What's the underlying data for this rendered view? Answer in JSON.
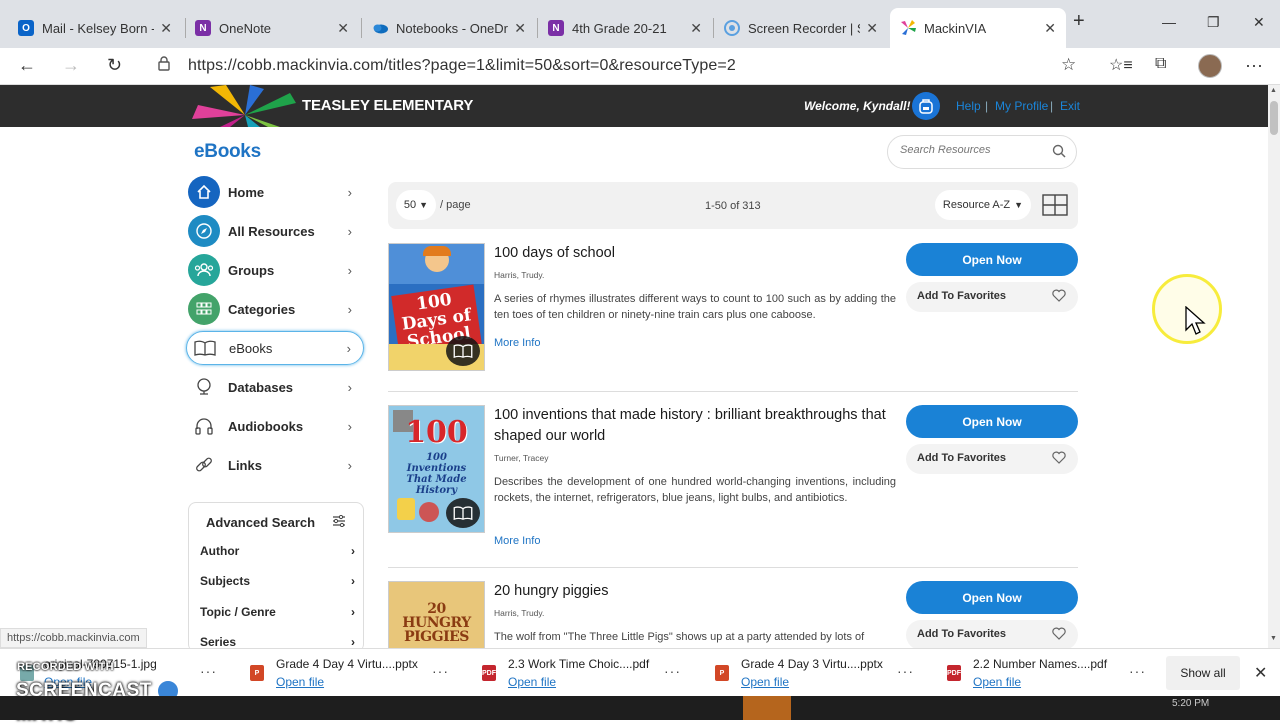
{
  "browser": {
    "tabs": [
      {
        "title": "Mail - Kelsey Born - O",
        "icon": "outlook-icon",
        "color": "#0a64c8",
        "letter": "O"
      },
      {
        "title": "OneNote",
        "icon": "onenote-icon",
        "color": "#7b2fa6",
        "letter": "N"
      },
      {
        "title": "Notebooks - OneDri",
        "icon": "onedrive-icon",
        "color": "#0f6cbd",
        "letter": ""
      },
      {
        "title": "4th Grade 20-21",
        "icon": "onenote-icon",
        "color": "#7b2fa6",
        "letter": "N"
      },
      {
        "title": "Screen Recorder | Sc",
        "icon": "screencast-icon",
        "color": "#5aa0e0",
        "letter": ""
      },
      {
        "title": "MackinVIA",
        "icon": "mackin-icon",
        "color": "#e0409a",
        "letter": ""
      }
    ],
    "url": "https://cobb.mackinvia.com/titles?page=1&limit=50&sort=0&resourceType=2"
  },
  "header": {
    "school": "TEASLEY ELEMENTARY",
    "welcome": "Welcome, Kyndall!",
    "help": "Help",
    "profile": "My Profile",
    "exit": "Exit",
    "sep": "|"
  },
  "sidebar": {
    "title": "eBooks",
    "items": [
      {
        "label": "Home",
        "icon": "home-icon",
        "color": "#1565c0"
      },
      {
        "label": "All Resources",
        "icon": "compass-icon",
        "color": "#1e8bc3"
      },
      {
        "label": "Groups",
        "icon": "users-icon",
        "color": "#26a69a"
      },
      {
        "label": "Categories",
        "icon": "grid-icon",
        "color": "#43a36a"
      },
      {
        "label": "eBooks",
        "icon": "book-icon",
        "color": "#ffffff"
      },
      {
        "label": "Databases",
        "icon": "globe-icon",
        "color": "#ffffff"
      },
      {
        "label": "Audiobooks",
        "icon": "headphones-icon",
        "color": "#ffffff"
      },
      {
        "label": "Links",
        "icon": "link-icon",
        "color": "#ffffff"
      }
    ],
    "advanced": {
      "title": "Advanced Search",
      "rows": [
        "Author",
        "Subjects",
        "Topic / Genre",
        "Series"
      ]
    }
  },
  "search": {
    "placeholder": "Search Resources"
  },
  "toolbar": {
    "per_page": "50",
    "per_page_label": "/ page",
    "count": "1-50 of 313",
    "sort": "Resource A-Z"
  },
  "resources": [
    {
      "title": "100 days of school",
      "author": "Harris, Trudy.",
      "description": "A series of rhymes illustrates different ways to count to 100 such as by adding the ten toes of ten children or ninety-nine train cars plus one caboose.",
      "more": "More Info",
      "open": "Open Now",
      "fav": "Add To Favorites",
      "cover_title": "100 Days of School",
      "cover_bg": "#2b6fc2"
    },
    {
      "title": "100 inventions that made history : brilliant breakthroughs that shaped our world",
      "author": "Turner, Tracey",
      "description": "Describes the development of one hundred world-changing inventions, including rockets, the internet, refrigerators, blue jeans, light bulbs, and antibiotics.",
      "more": "More Info",
      "open": "Open Now",
      "fav": "Add To Favorites",
      "cover_title": "100 Inventions That Made History",
      "cover_bg": "#8fc8e6"
    },
    {
      "title": "20 hungry piggies",
      "author": "Harris, Trudy.",
      "description": "The wolf from \"The Three Little Pigs\" shows up at a party attended by lots of",
      "open": "Open Now",
      "fav": "Add To Favorites",
      "cover_title": "20 HUNGRY PIGGIES",
      "cover_bg": "#e8c67a"
    }
  ],
  "status_url": "https://cobb.mackinvia.com",
  "downloads": [
    {
      "name": "original-790715-1.jpg",
      "open": "Open file",
      "type": "jpg"
    },
    {
      "name": "Grade 4 Day 4 Virtu....pptx",
      "open": "Open file",
      "type": "pptx"
    },
    {
      "name": "2.3 Work Time Choic....pdf",
      "open": "Open file",
      "type": "pdf"
    },
    {
      "name": "Grade 4 Day 3 Virtu....pptx",
      "open": "Open file",
      "type": "pptx"
    },
    {
      "name": "2.2 Number Names....pdf",
      "open": "Open file",
      "type": "pdf"
    }
  ],
  "show_all": "Show all",
  "watermark": {
    "line1": "RECORDED WITH",
    "line2a": "SCREENCAST",
    "line2b": "MATIC"
  },
  "clock": "5:20 PM"
}
